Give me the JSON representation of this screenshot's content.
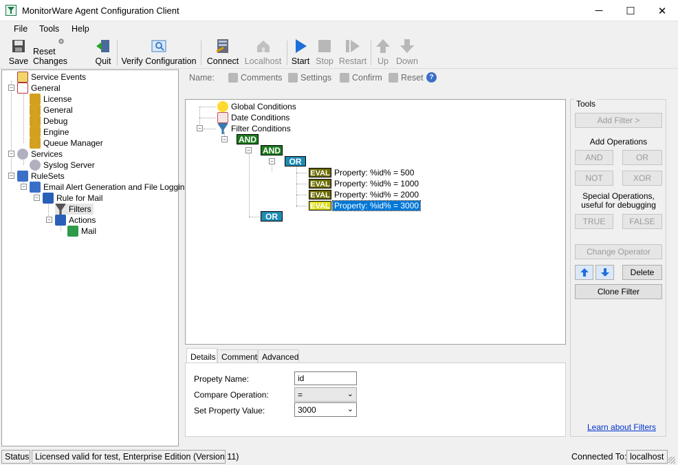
{
  "window": {
    "title": "MonitorWare Agent Configuration Client",
    "minimize": "─",
    "maximize": "☐",
    "close": "✕"
  },
  "menu": [
    "File",
    "Tools",
    "Help"
  ],
  "toolbar": {
    "save": "Save",
    "reset_changes": "Reset Changes",
    "quit": "Quit",
    "verify": "Verify Configuration",
    "connect": "Connect",
    "localhost": "Localhost",
    "start": "Start",
    "stop": "Stop",
    "restart": "Restart",
    "up": "Up",
    "down": "Down"
  },
  "tree": {
    "service_events": "Service Events",
    "general": "General",
    "license": "License",
    "general_child": "General",
    "debug": "Debug",
    "engine": "Engine",
    "queue_manager": "Queue Manager",
    "services": "Services",
    "syslog_server": "Syslog Server",
    "rulesets": "RuleSets",
    "ruleset_email": "Email Alert Generation and File Logging",
    "rule_for_mail": "Rule for Mail",
    "filters": "Filters",
    "actions": "Actions",
    "mail": "Mail"
  },
  "filterbar": {
    "name_label": "Name:",
    "comments": "Comments",
    "settings": "Settings",
    "confirm": "Confirm",
    "reset": "Reset"
  },
  "filter_tree": {
    "global_conditions": "Global Conditions",
    "date_conditions": "Date Conditions",
    "filter_conditions": "Filter Conditions",
    "op_and1": "AND",
    "op_and2": "AND",
    "op_or1": "OR",
    "op_or2": "OR",
    "eval_label": "EVAL",
    "props": [
      "Property: %id% = 500",
      "Property: %id% = 1000",
      "Property: %id% = 2000",
      "Property: %id% = 3000"
    ]
  },
  "tabs": {
    "details": "Details",
    "comments": "Comments",
    "advanced": "Advanced"
  },
  "details": {
    "property_name_label": "Propety Name:",
    "property_name_value": "id",
    "compare_label": "Compare Operation:",
    "compare_value": "=",
    "set_value_label": "Set Property Value:",
    "set_value_value": "3000"
  },
  "tools": {
    "title": "Tools",
    "add_filter": "Add Filter >",
    "add_operations": "Add Operations",
    "and": "AND",
    "or": "OR",
    "not": "NOT",
    "xor": "XOR",
    "special_ops": "Special Operations,",
    "special_ops2": "useful for debugging",
    "true": "TRUE",
    "false": "FALSE",
    "change_operator": "Change Operator",
    "delete": "Delete",
    "clone_filter": "Clone Filter",
    "learn": "Learn about Filters"
  },
  "status": {
    "label": "Status",
    "license": "Licensed valid for test, Enterprise Edition (Version 11)",
    "connected_label": "Connected To:",
    "host": "localhost"
  },
  "colors": {
    "and_op": "#1e7a1e",
    "or_op": "#1f8bb3",
    "eval": "#6b6b00",
    "selection": "#0078d7"
  }
}
